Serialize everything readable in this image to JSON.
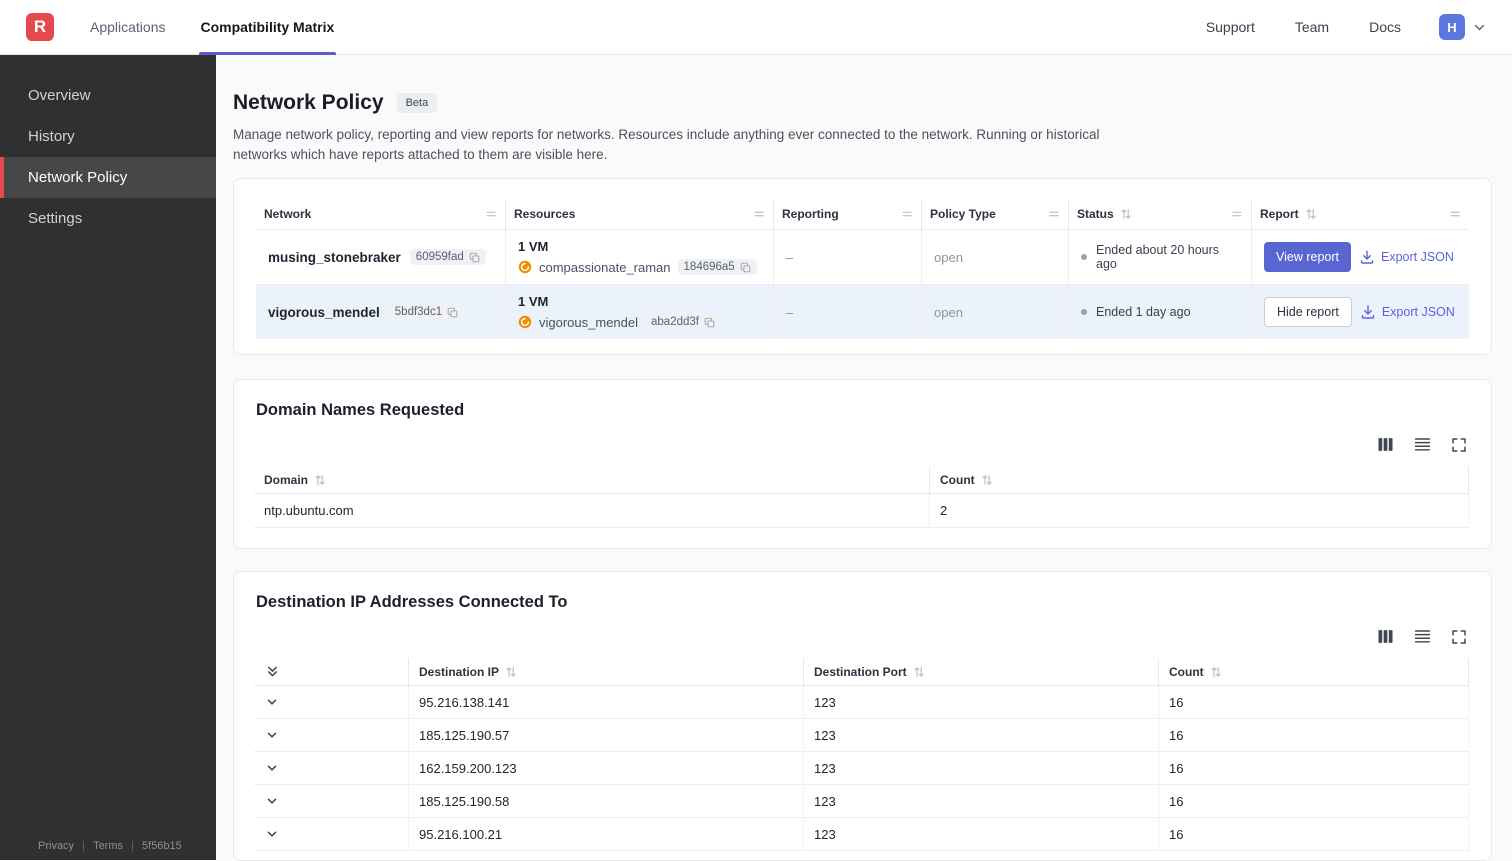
{
  "colors": {
    "brand_red": "#e5484d",
    "accent_indigo": "#5966d2",
    "tab_underline": "#5b5bd6",
    "avatar_blue": "#5b78e0",
    "row_highlight": "#ebf2fc",
    "sidebar_bg": "#303030",
    "vm_icon_orange": "#f08c00"
  },
  "topnav": {
    "logo_letter": "R",
    "tabs": [
      {
        "label": "Applications",
        "active": false
      },
      {
        "label": "Compatibility Matrix",
        "active": true
      }
    ],
    "links": [
      {
        "label": "Support"
      },
      {
        "label": "Team"
      },
      {
        "label": "Docs"
      }
    ],
    "avatar_initial": "H"
  },
  "sidebar": {
    "items": [
      {
        "label": "Overview",
        "active": false
      },
      {
        "label": "History",
        "active": false
      },
      {
        "label": "Network Policy",
        "active": true
      },
      {
        "label": "Settings",
        "active": false
      }
    ],
    "footer": {
      "privacy_label": "Privacy",
      "terms_label": "Terms",
      "build_id": "5f56b15"
    }
  },
  "page": {
    "title": "Network Policy",
    "beta_badge": "Beta",
    "description": "Manage network policy, reporting and view reports for networks. Resources include anything ever connected to the network. Running or historical networks which have reports attached to them are visible here."
  },
  "networks_table": {
    "headers": {
      "network": "Network",
      "resources": "Resources",
      "reporting": "Reporting",
      "policy_type": "Policy Type",
      "status": "Status",
      "report": "Report"
    },
    "rows": [
      {
        "network_name": "musing_stonebraker",
        "network_id": "60959fad",
        "vm_count": "1 VM",
        "resource_name": "compassionate_raman",
        "resource_id": "184696a5",
        "reporting": "–",
        "policy_type": "open",
        "status_text": "Ended about 20 hours ago",
        "report_action": "View report",
        "export_action": "Export JSON"
      },
      {
        "network_name": "vigorous_mendel",
        "network_id": "5bdf3dc1",
        "vm_count": "1 VM",
        "resource_name": "vigorous_mendel",
        "resource_id": "aba2dd3f",
        "reporting": "–",
        "policy_type": "open",
        "status_text": "Ended 1 day ago",
        "report_action": "Hide report",
        "export_action": "Export JSON"
      }
    ]
  },
  "domains_table": {
    "title": "Domain Names Requested",
    "headers": {
      "domain": "Domain",
      "count": "Count"
    },
    "rows": [
      {
        "domain": "ntp.ubuntu.com",
        "count": "2"
      }
    ]
  },
  "destinations_table": {
    "title": "Destination IP Addresses Connected To",
    "headers": {
      "destination_ip": "Destination IP",
      "destination_port": "Destination Port",
      "count": "Count"
    },
    "rows": [
      {
        "ip": "95.216.138.141",
        "port": "123",
        "count": "16"
      },
      {
        "ip": "185.125.190.57",
        "port": "123",
        "count": "16"
      },
      {
        "ip": "162.159.200.123",
        "port": "123",
        "count": "16"
      },
      {
        "ip": "185.125.190.58",
        "port": "123",
        "count": "16"
      },
      {
        "ip": "95.216.100.21",
        "port": "123",
        "count": "16"
      }
    ]
  }
}
